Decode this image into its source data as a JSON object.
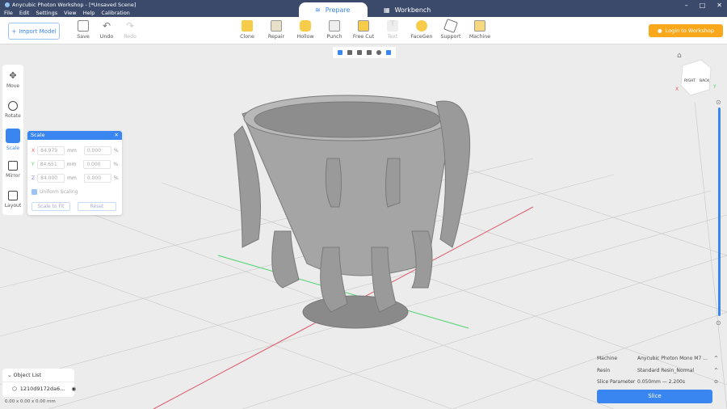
{
  "app": {
    "title": "Anycubic Photon Workshop - [*Unsaved Scene]",
    "menu": [
      "File",
      "Edit",
      "Settings",
      "View",
      "Help",
      "Calibration"
    ]
  },
  "tabs": [
    {
      "label": "Prepare"
    },
    {
      "label": "Workbench"
    }
  ],
  "toolbar": {
    "import": "Import Model",
    "save": "Save",
    "undo": "Undo",
    "redo": "Redo",
    "tools": [
      "Clone",
      "Repair",
      "Hollow",
      "Punch",
      "Free Cut",
      "Text",
      "FaceGen",
      "Support",
      "Machine"
    ],
    "login": "Login to Workshop"
  },
  "left_tools": [
    "Move",
    "Rotate",
    "Scale",
    "Mirror",
    "Layout"
  ],
  "scale_panel": {
    "title": "Scale",
    "x": "84.979",
    "y": "84.651",
    "z": "84.000",
    "unit": "mm",
    "pct_x": "0.000",
    "pct_y": "0.000",
    "pct_z": "0.000",
    "pct": "%",
    "uniform": "Uniform Scaling",
    "scale_to_fit": "Scale to Fit",
    "reset": "Reset",
    "labels": [
      "X",
      "Y",
      "Z"
    ]
  },
  "object_list": {
    "title": "Object List",
    "item": "1210d9172da6...",
    "dims": "0.00 x 0.00 x 0.00 mm"
  },
  "view_cube": {
    "right": "RIGHT",
    "back": "BACK",
    "x": "X",
    "y": "Y"
  },
  "slice_panel": {
    "machine_label": "Machine",
    "machine": "Anycubic Photon Mono M7 ...",
    "resin_label": "Resin",
    "resin": "Standard Resin_Normal",
    "param_label": "Slice Parameter",
    "param": "0.050mm — 2.200s",
    "slice": "Slice"
  },
  "colors": {
    "accent": "#3a86f0",
    "titlebar": "#3b4a6b",
    "login": "#f9a81b"
  }
}
